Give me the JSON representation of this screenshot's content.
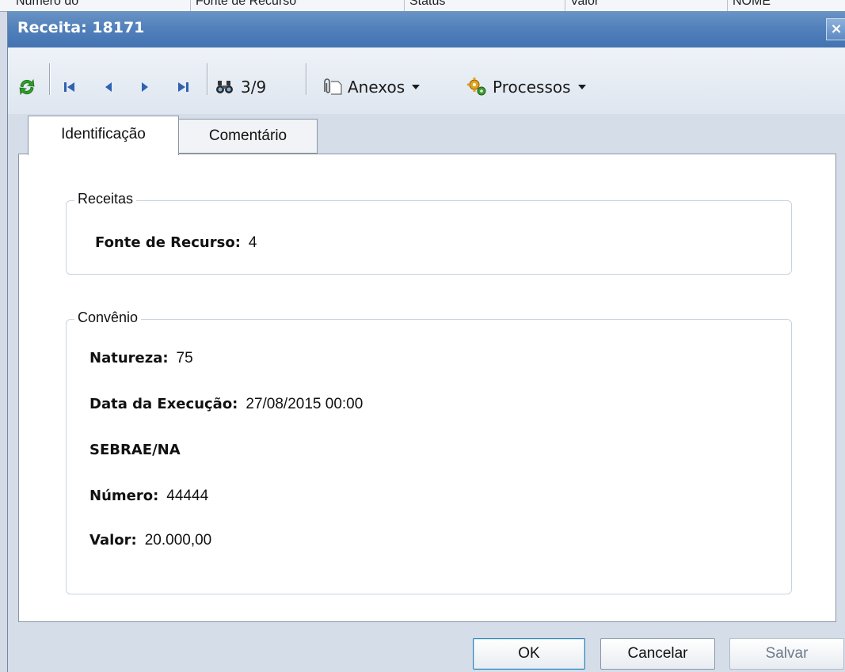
{
  "background_grid": {
    "columns": [
      "Número do",
      "Fonte de Recurso",
      "Status",
      "Valor",
      "NOME"
    ]
  },
  "window": {
    "title": "Receita: 18171",
    "close_glyph": "×"
  },
  "toolbar": {
    "refresh_icon": "refresh-icon",
    "record_position": "3/9",
    "anexos_label": "Anexos",
    "processos_label": "Processos"
  },
  "tabs": [
    {
      "label": "Identificação",
      "active": true
    },
    {
      "label": "Comentário",
      "active": false
    }
  ],
  "groups": {
    "receitas": {
      "legend": "Receitas",
      "fields": [
        {
          "label": "Fonte de Recurso:",
          "value": "4"
        }
      ]
    },
    "convenio": {
      "legend": "Convênio",
      "fields": [
        {
          "label": "Natureza:",
          "value": "75"
        },
        {
          "label": "Data da Execução:",
          "value": "27/08/2015 00:00"
        },
        {
          "label": "SEBRAE/NA",
          "value": ""
        },
        {
          "label": "Número:",
          "value": "44444"
        },
        {
          "label": "Valor:",
          "value": "20.000,00"
        }
      ]
    }
  },
  "buttons": {
    "ok": "OK",
    "cancel": "Cancelar",
    "save": "Salvar"
  },
  "colors": {
    "titlebar": "#5281bb",
    "refresh_green": "#2e9e2a",
    "nav_blue": "#2f62b0"
  }
}
